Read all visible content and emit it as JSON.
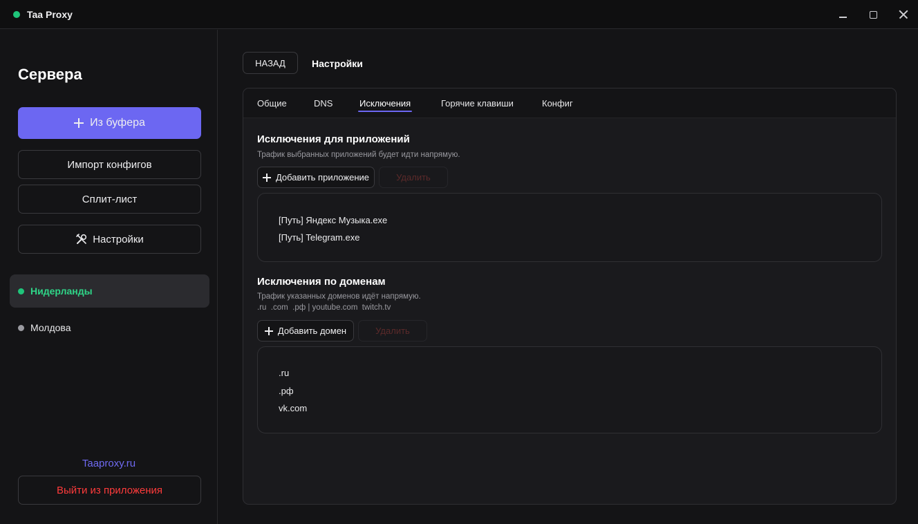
{
  "window": {
    "title": "Taa Proxy"
  },
  "sidebar": {
    "title": "Сервера",
    "from_clipboard": "Из буфера",
    "import_configs": "Импорт конфигов",
    "split_list": "Сплит-лист",
    "settings": "Настройки",
    "servers": [
      {
        "name": "Нидерланды",
        "active": true
      },
      {
        "name": "Молдова",
        "active": false
      }
    ],
    "site_link": "Taaproxy.ru",
    "exit": "Выйти из приложения"
  },
  "header": {
    "back": "НАЗАД",
    "title": "Настройки"
  },
  "tabs": [
    {
      "label": "Общие"
    },
    {
      "label": "DNS"
    },
    {
      "label": "Исключения",
      "active": true
    },
    {
      "label": "Горячие клавиши"
    },
    {
      "label": "Конфиг"
    }
  ],
  "apps_section": {
    "title": "Исключения для приложений",
    "subtitle": "Трафик выбранных приложений будет идти напрямую.",
    "add_label": "Добавить приложение",
    "delete_label": "Удалить",
    "items": [
      "[Путь] Яндекс Музыка.exe",
      "[Путь] Telegram.exe"
    ]
  },
  "domains_section": {
    "title": "Исключения по доменам",
    "subtitle": "Трафик указанных доменов идёт напрямую.",
    "hint": ".ru  .com  .рф | youtube.com  twitch.tv",
    "add_label": "Добавить домен",
    "delete_label": "Удалить",
    "items": [
      ".ru",
      ".рф",
      "vk.com"
    ]
  },
  "colors": {
    "accent": "#6c67f2",
    "online": "#1fc47a",
    "danger": "#ff3b3b"
  }
}
